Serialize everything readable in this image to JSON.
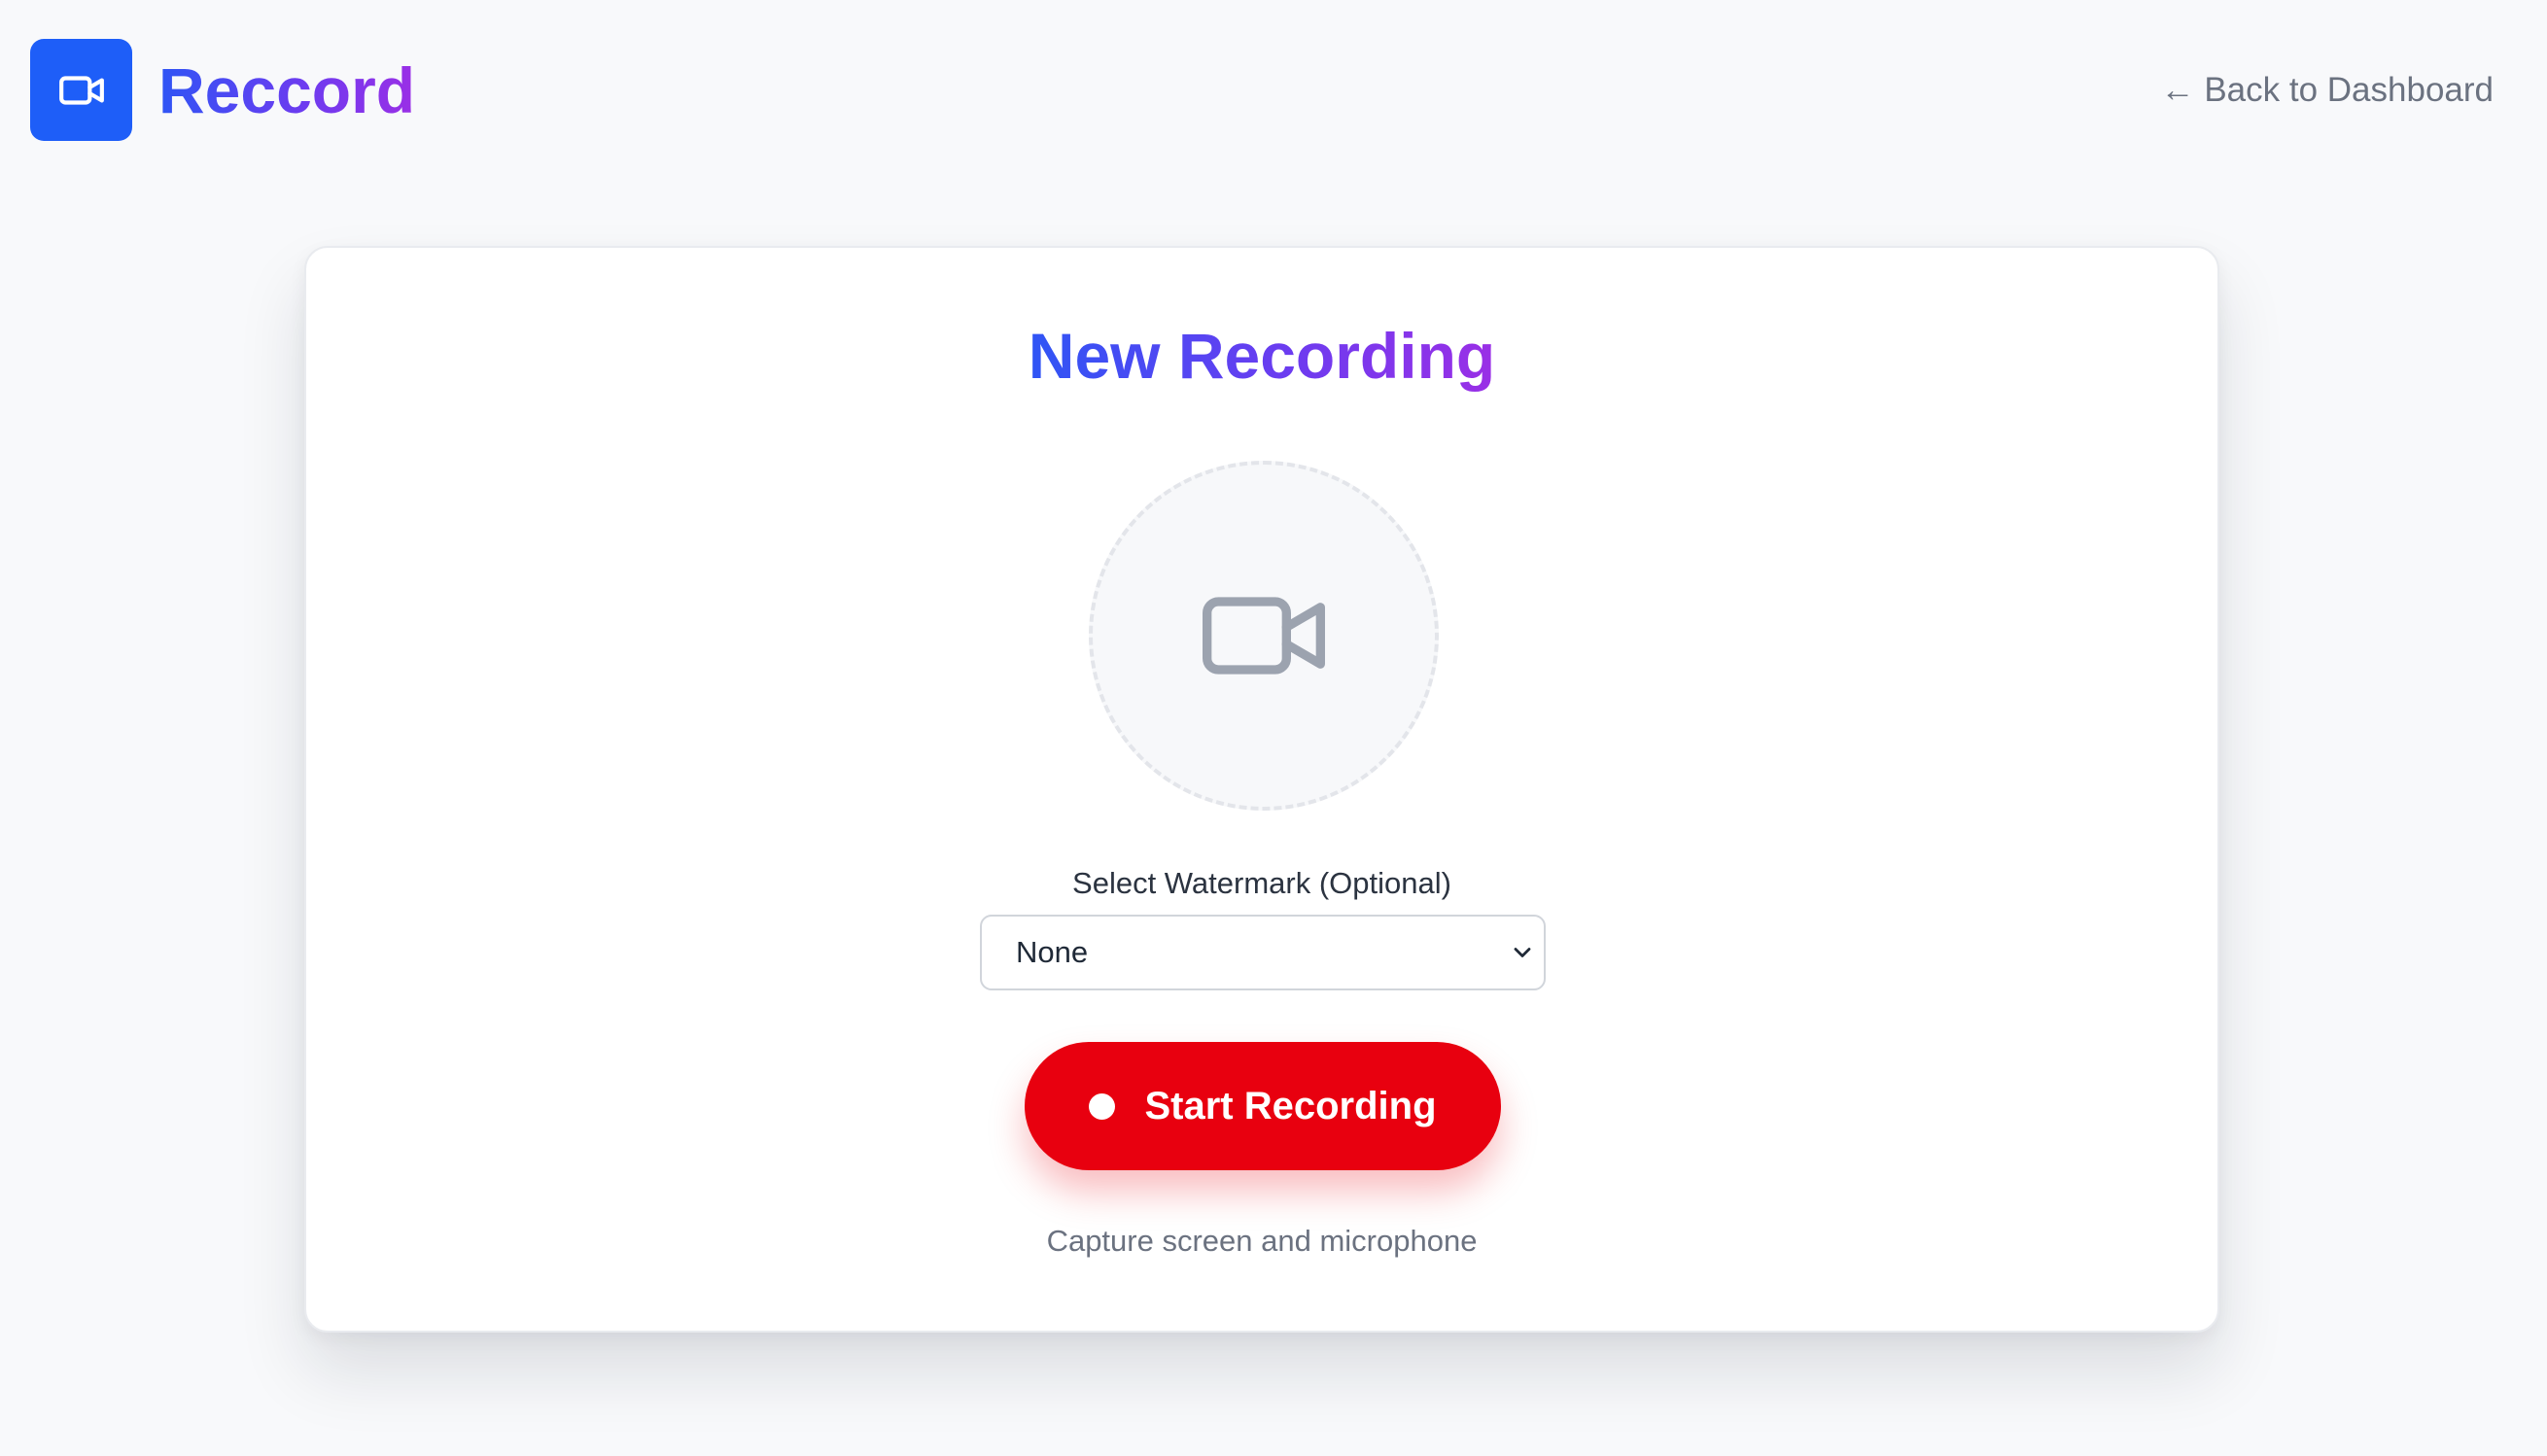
{
  "header": {
    "logo_icon": "video-camera-icon",
    "app_name": "Reccord",
    "back_link": "← Back to Dashboard"
  },
  "card": {
    "title": "New Recording",
    "preview_icon": "video-camera-icon",
    "watermark_label": "Select Watermark (Optional)",
    "watermark_selected": "None",
    "start_button": "Start Recording",
    "caption": "Capture screen and microphone"
  },
  "colors": {
    "brand_blue": "#1e5ef8",
    "gradient_start": "#2f55f5",
    "gradient_end": "#9a2fe6",
    "record_red": "#e8000f",
    "muted_text": "#6b7280",
    "page_background": "#f8f9fb"
  }
}
